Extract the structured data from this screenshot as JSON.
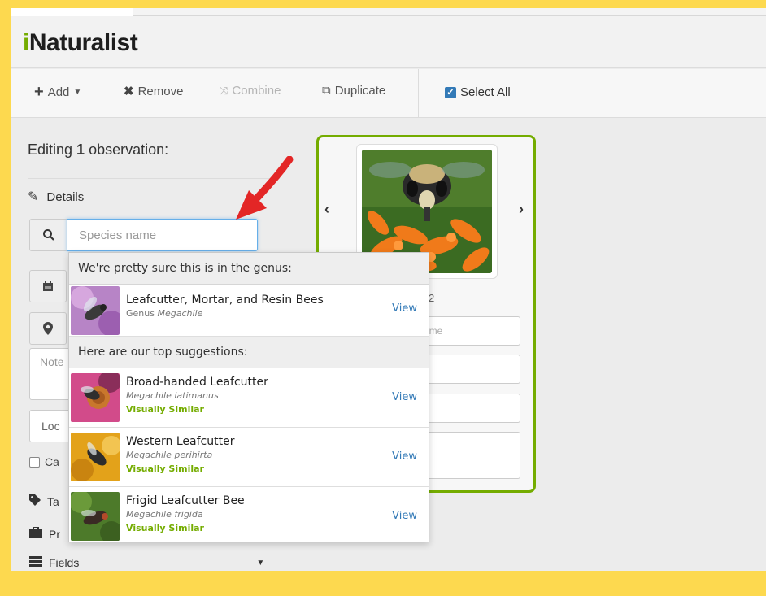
{
  "app": {
    "logo_i": "i",
    "logo_rest": "Naturalist",
    "accent_color": "#74ac00",
    "page_border_color": "#fdd94f"
  },
  "toolbar": {
    "add_label": "Add",
    "remove_label": "Remove",
    "combine_label": "Combine",
    "duplicate_label": "Duplicate",
    "select_all_label": "Select All",
    "select_all_checked": true
  },
  "editor": {
    "editing_prefix": "Editing ",
    "editing_count": "1",
    "editing_suffix": " observation:",
    "details_label": "Details",
    "species_placeholder": "Species name",
    "notes_placeholder": "Note",
    "location_placeholder": "Loc",
    "captive_label": "Ca",
    "tags_label": "Ta",
    "projects_label": "Pr",
    "fields_label": "Fields"
  },
  "card": {
    "count_fragment": "2",
    "name_placeholder_fragment": "ame"
  },
  "suggestions": {
    "genus_header": "We're pretty sure this is in the genus:",
    "genus": {
      "common": "Leafcutter, Mortar, and Resin Bees",
      "rank": "Genus",
      "sci": "Megachile",
      "view": "View"
    },
    "top_header": "Here are our top suggestions:",
    "items": [
      {
        "common": "Broad-handed Leafcutter",
        "sci": "Megachile latimanus",
        "badge": "Visually Similar",
        "view": "View"
      },
      {
        "common": "Western Leafcutter",
        "sci": "Megachile perihirta",
        "badge": "Visually Similar",
        "view": "View"
      },
      {
        "common": "Frigid Leafcutter Bee",
        "sci": "Megachile frigida",
        "badge": "Visually Similar",
        "view": "View"
      }
    ]
  },
  "icons": [
    "plus-icon",
    "caret-down-icon",
    "times-icon",
    "combine-icon",
    "duplicate-icon",
    "check-icon",
    "pencil-icon",
    "search-icon",
    "calendar-icon",
    "map-marker-icon",
    "tag-icon",
    "briefcase-icon",
    "list-icon",
    "chevron-left-icon",
    "chevron-right-icon",
    "red-arrow-icon"
  ]
}
